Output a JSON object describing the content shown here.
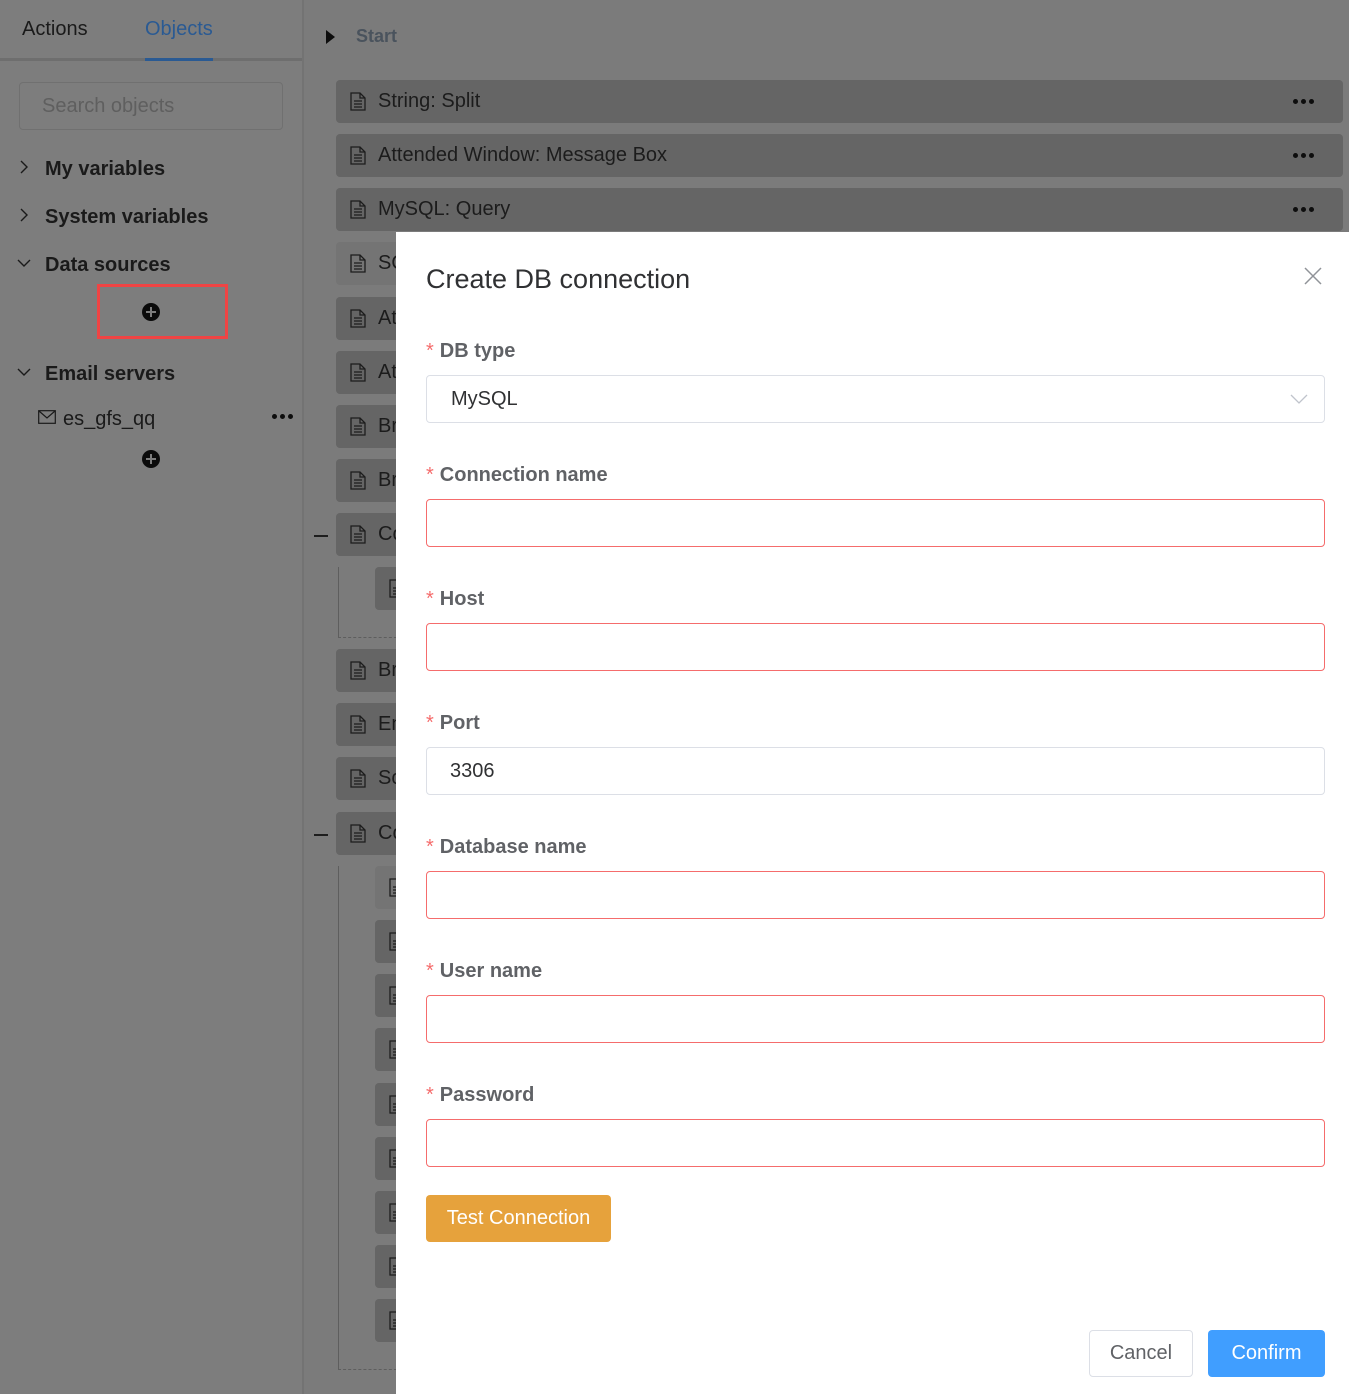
{
  "left_panel": {
    "tabs": [
      {
        "label": "Actions",
        "active": false
      },
      {
        "label": "Objects",
        "active": true
      }
    ],
    "search": {
      "placeholder": "Search objects",
      "value": ""
    },
    "sections": [
      {
        "label": "My variables",
        "expanded": false
      },
      {
        "label": "System variables",
        "expanded": false
      },
      {
        "label": "Data sources",
        "expanded": true
      },
      {
        "label": "Email servers",
        "expanded": true
      }
    ],
    "email_servers": [
      {
        "name": "es_gfs_qq",
        "icon": "mail-icon"
      }
    ],
    "add_icon": "plus-circle-icon"
  },
  "workflow": {
    "start_label": "Start",
    "steps": [
      {
        "label": "String: Split"
      },
      {
        "label": "Attended Window: Message Box"
      },
      {
        "label": "MySQL: Query"
      },
      {
        "label": "SQ"
      },
      {
        "label": "At"
      },
      {
        "label": "At"
      },
      {
        "label": "Br"
      },
      {
        "label": "Br"
      },
      {
        "label": "Co"
      },
      {
        "label": ""
      },
      {
        "label": "Br"
      },
      {
        "label": "En"
      },
      {
        "label": "Sc"
      },
      {
        "label": "Co"
      },
      {
        "label": ""
      },
      {
        "label": ""
      },
      {
        "label": ""
      },
      {
        "label": ""
      },
      {
        "label": ""
      },
      {
        "label": ""
      },
      {
        "label": ""
      },
      {
        "label": ""
      },
      {
        "label": ""
      }
    ],
    "step_icon": "document-icon",
    "more_icon": "more-dots-icon"
  },
  "modal": {
    "title": "Create DB connection",
    "close_icon": "close-icon",
    "required_mark": "*",
    "fields": {
      "db_type": {
        "label": "DB type",
        "value": "MySQL"
      },
      "connection_name": {
        "label": "Connection name",
        "value": ""
      },
      "host": {
        "label": "Host",
        "value": ""
      },
      "port": {
        "label": "Port",
        "value": "3306"
      },
      "database_name": {
        "label": "Database name",
        "value": ""
      },
      "user_name": {
        "label": "User name",
        "value": ""
      },
      "password": {
        "label": "Password",
        "value": ""
      }
    },
    "test_button": "Test Connection",
    "cancel_button": "Cancel",
    "confirm_button": "Confirm"
  },
  "colors": {
    "accent_blue": "#409eff",
    "warning_orange": "#e6a23c",
    "error_red": "#f56c6c",
    "highlight_red": "#ef4444",
    "active_tab": "#2a5a93"
  }
}
